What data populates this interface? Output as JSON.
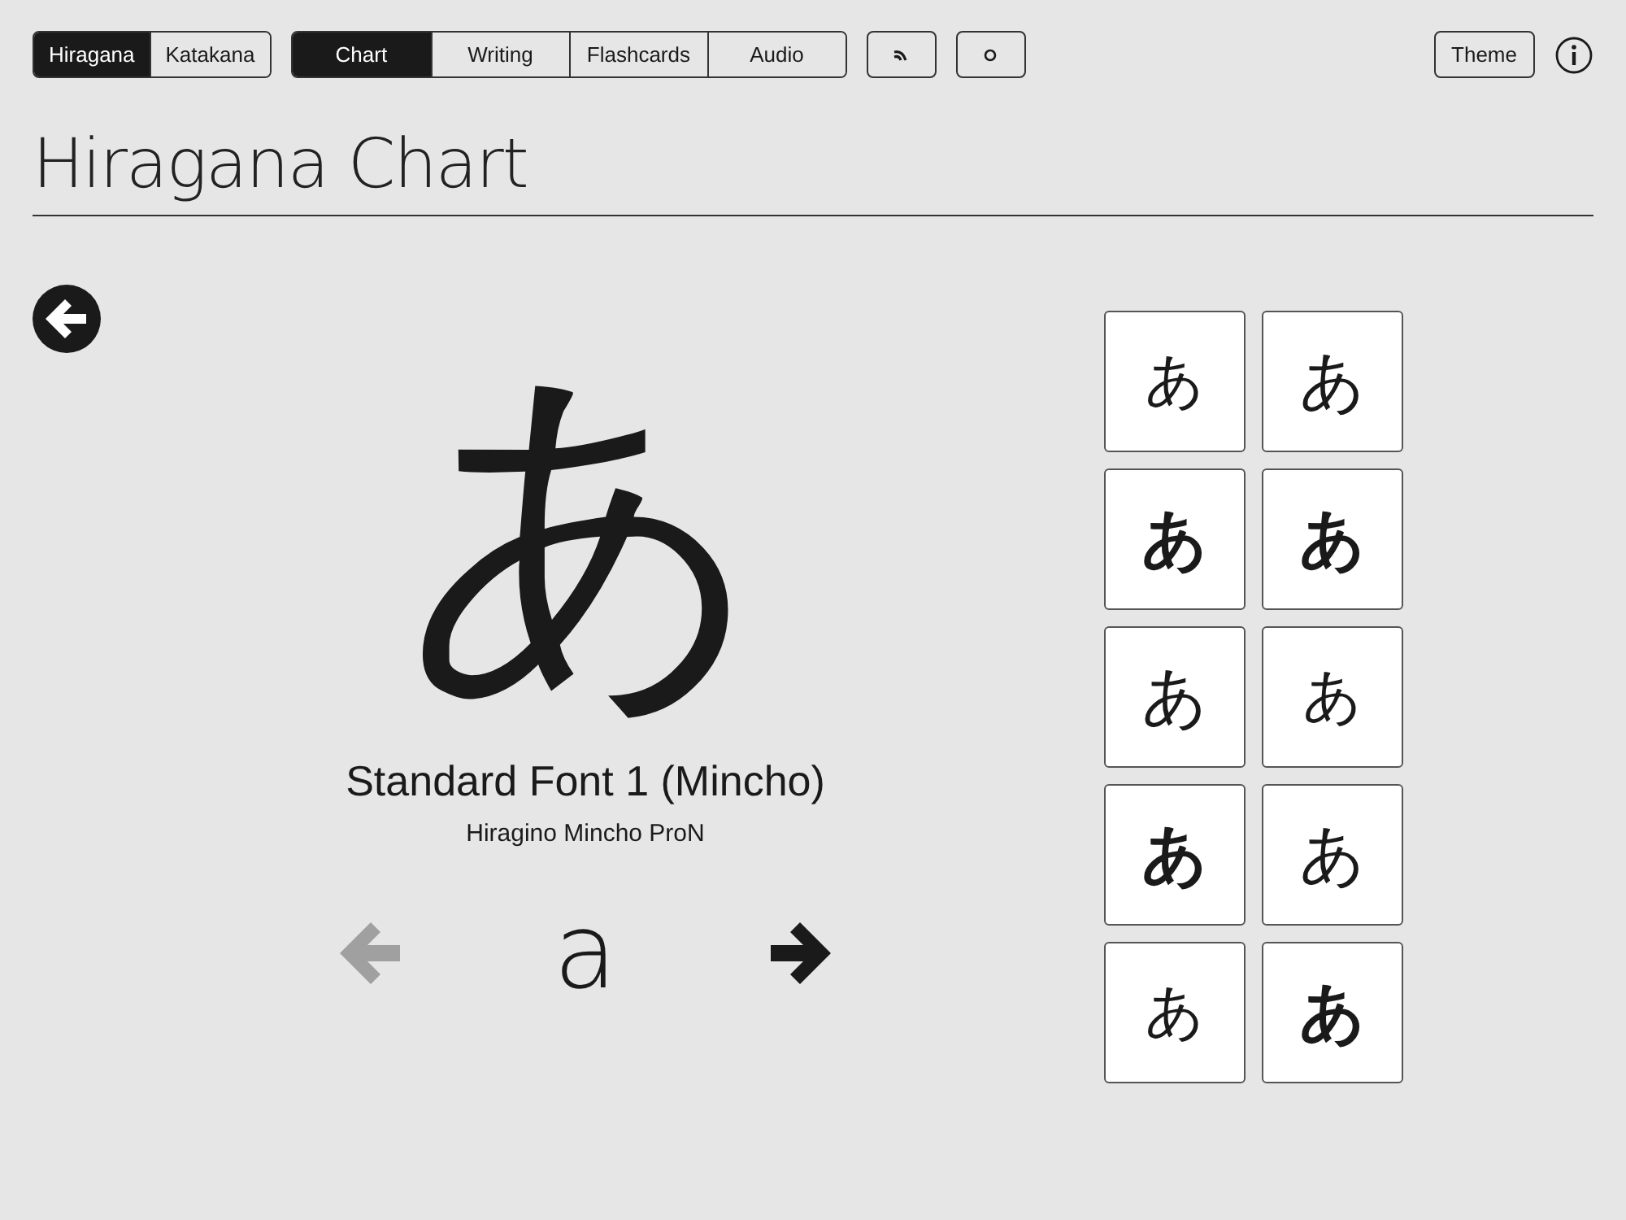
{
  "script_tabs": [
    {
      "label": "Hiragana",
      "selected": true
    },
    {
      "label": "Katakana",
      "selected": false
    }
  ],
  "mode_tabs": [
    {
      "label": "Chart",
      "selected": true
    },
    {
      "label": "Writing",
      "selected": false
    },
    {
      "label": "Flashcards",
      "selected": false
    },
    {
      "label": "Audio",
      "selected": false
    }
  ],
  "theme_button": "Theme",
  "title": "Hiragana Chart",
  "character": "あ",
  "font_name": "Standard Font 1 (Mincho)",
  "font_family": "Hiragino Mincho ProN",
  "romaji": "a",
  "prev_disabled": true,
  "next_disabled": false,
  "font_tiles": [
    {
      "char": "あ",
      "kind": "light"
    },
    {
      "char": "あ",
      "kind": "regular"
    },
    {
      "char": "あ",
      "kind": "bold"
    },
    {
      "char": "あ",
      "kind": "bold"
    },
    {
      "char": "あ",
      "kind": "regular"
    },
    {
      "char": "あ",
      "kind": "light"
    },
    {
      "char": "あ",
      "kind": "bold"
    },
    {
      "char": "あ",
      "kind": "regular"
    },
    {
      "char": "あ",
      "kind": "light"
    },
    {
      "char": "あ",
      "kind": "bold"
    }
  ]
}
